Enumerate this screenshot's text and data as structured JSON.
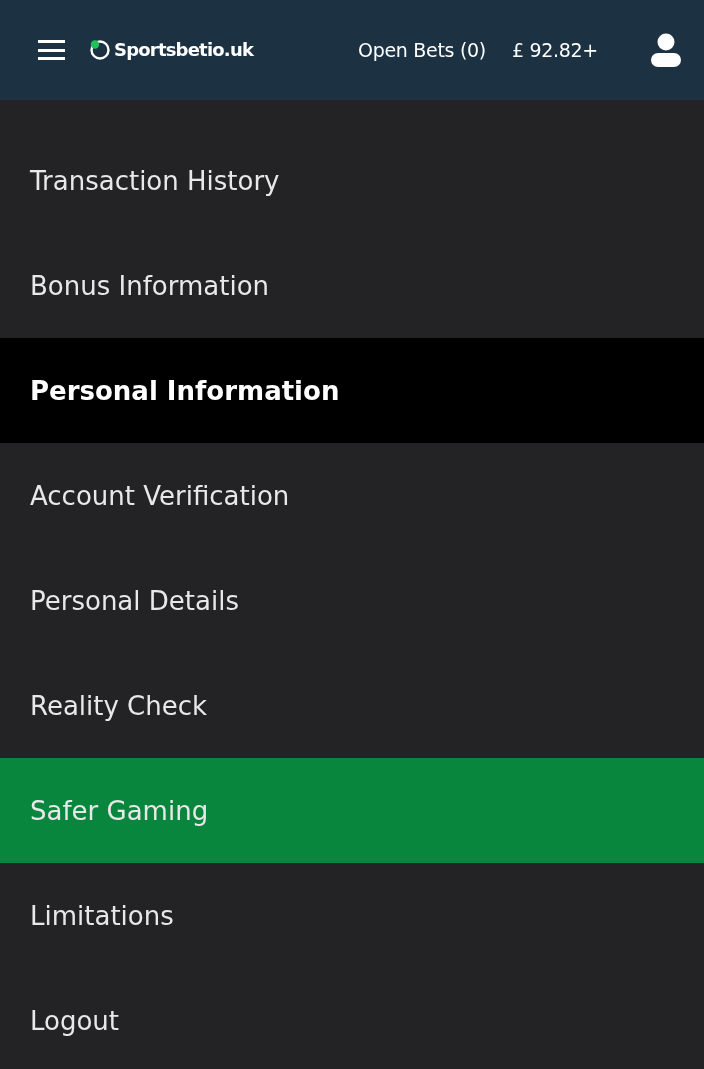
{
  "header": {
    "logo_text": "Sportsbetio.uk",
    "open_bets": "Open Bets (0)",
    "balance": "£ 92.82+"
  },
  "menu": [
    {
      "kind": "link",
      "label": "Transaction History",
      "selected": false
    },
    {
      "kind": "link",
      "label": "Bonus Information",
      "selected": false
    },
    {
      "kind": "section",
      "label": "Personal Information",
      "selected": false
    },
    {
      "kind": "link",
      "label": "Account Verification",
      "selected": false
    },
    {
      "kind": "link",
      "label": "Personal Details",
      "selected": false
    },
    {
      "kind": "link",
      "label": "Reality Check",
      "selected": false
    },
    {
      "kind": "link",
      "label": "Safer Gaming",
      "selected": true
    },
    {
      "kind": "link",
      "label": "Limitations",
      "selected": false
    },
    {
      "kind": "link",
      "label": "Logout",
      "selected": false
    }
  ]
}
